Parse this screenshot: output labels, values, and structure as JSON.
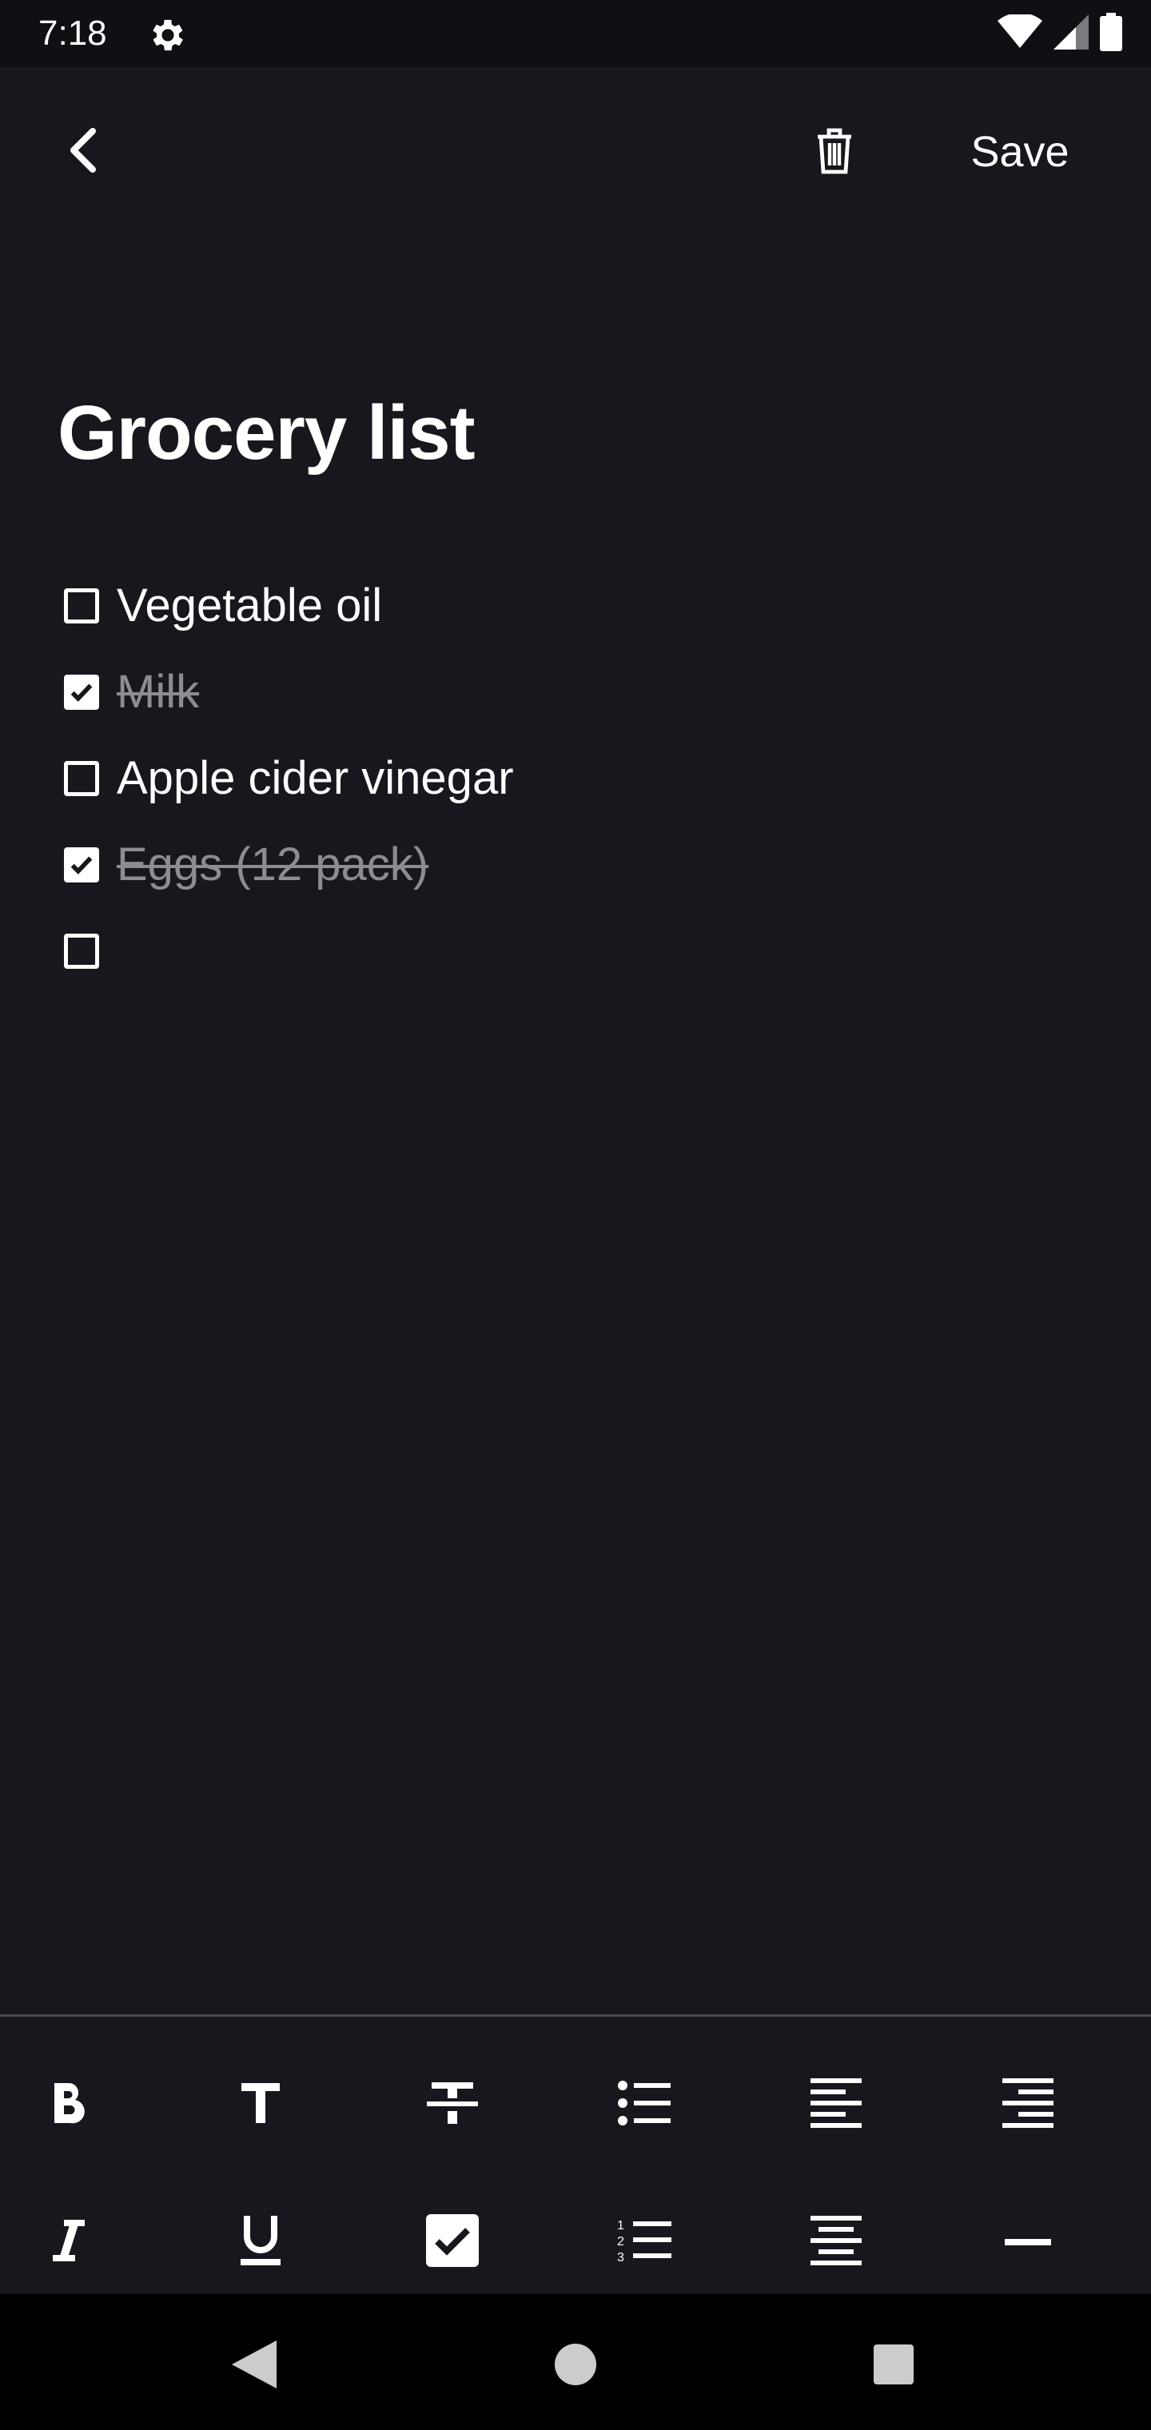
{
  "status_bar": {
    "time": "7:18",
    "icons": [
      "gear-icon",
      "wifi-icon",
      "cell-signal-icon",
      "battery-icon"
    ]
  },
  "app_bar": {
    "back_icon": "chevron-left-icon",
    "delete_icon": "trash-icon",
    "save_label": "Save"
  },
  "note": {
    "title": "Grocery list",
    "items": [
      {
        "text": "Vegetable oil",
        "checked": false
      },
      {
        "text": "Milk",
        "checked": true
      },
      {
        "text": "Apple cider vinegar",
        "checked": false
      },
      {
        "text": "Eggs (12 pack)",
        "checked": true
      },
      {
        "text": "",
        "checked": false
      }
    ]
  },
  "toolbar": {
    "row1": [
      "bold-icon",
      "text-size-icon",
      "strikethrough-icon",
      "bulleted-list-icon",
      "align-left-icon",
      "align-right-icon"
    ],
    "row2": [
      "italic-icon",
      "underline-icon",
      "checklist-icon",
      "numbered-list-icon",
      "align-center-icon",
      "horizontal-rule-icon"
    ]
  },
  "nav_bar": {
    "icons": [
      "back-triangle-icon",
      "home-circle-icon",
      "recents-square-icon"
    ]
  },
  "colors": {
    "background": "#18171e",
    "status_bar": "#0f0f14",
    "text": "#ffffff",
    "done_text": "#8d8c93",
    "divider": "#4a4a52"
  }
}
